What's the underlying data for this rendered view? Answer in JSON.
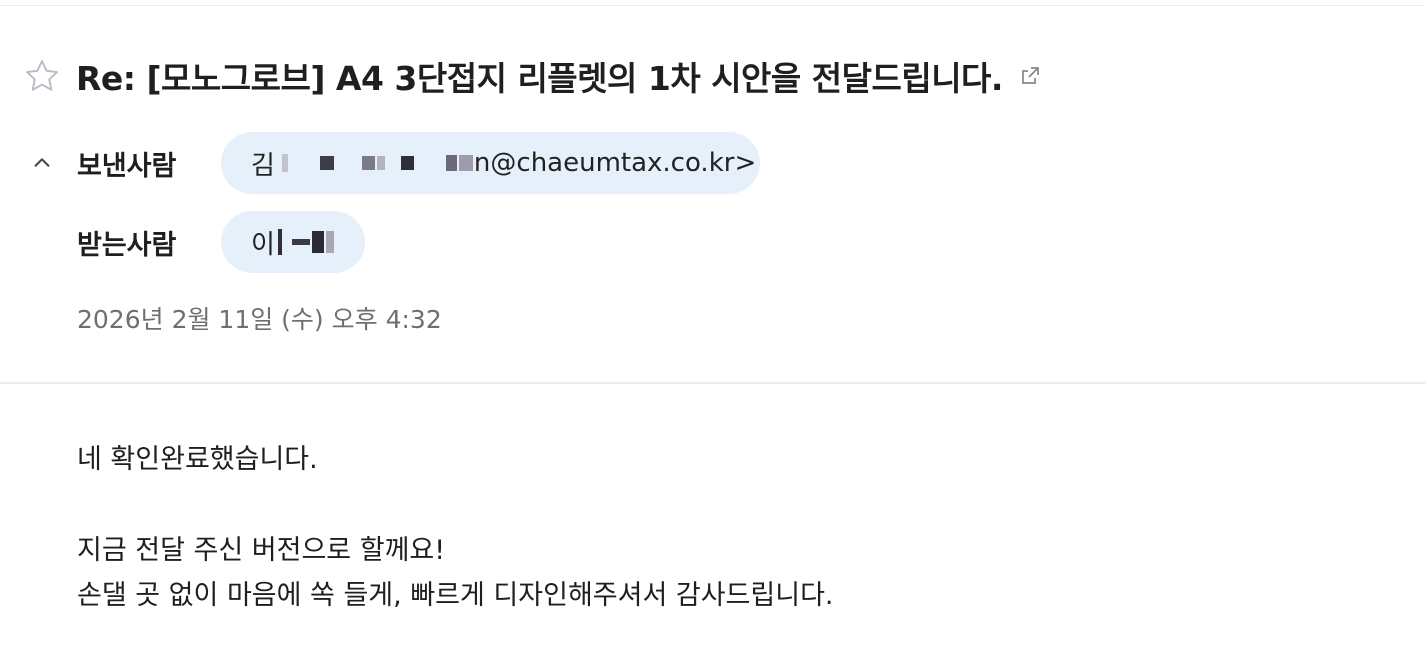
{
  "email": {
    "subject": "Re: [모노그로브] A4 3단접지 리플렛의 1차 시안을 전달드립니다.",
    "sender_label": "보낸사람",
    "sender_name_initial": "김",
    "sender_email_suffix": "n@chaeumtax.co.kr>",
    "recipient_label": "받는사람",
    "recipient_name_initial": "이",
    "date": "2026년 2월 11일 (수) 오후 4:32",
    "body_lines": [
      "네 확인완료했습니다.",
      "지금 전달 주신 버전으로 할께요!",
      "손댈 곳 없이 마음에 쏙 들게, 빠르게 디자인해주셔서 감사드립니다."
    ]
  },
  "icons": {
    "star": "star-outline-icon",
    "popout": "open-in-new-window-icon",
    "collapse": "chevron-up-icon"
  },
  "colors": {
    "chip_background": "#e6f0fb",
    "date_text": "#6f6f6f",
    "title_text": "#1f1f1f"
  }
}
